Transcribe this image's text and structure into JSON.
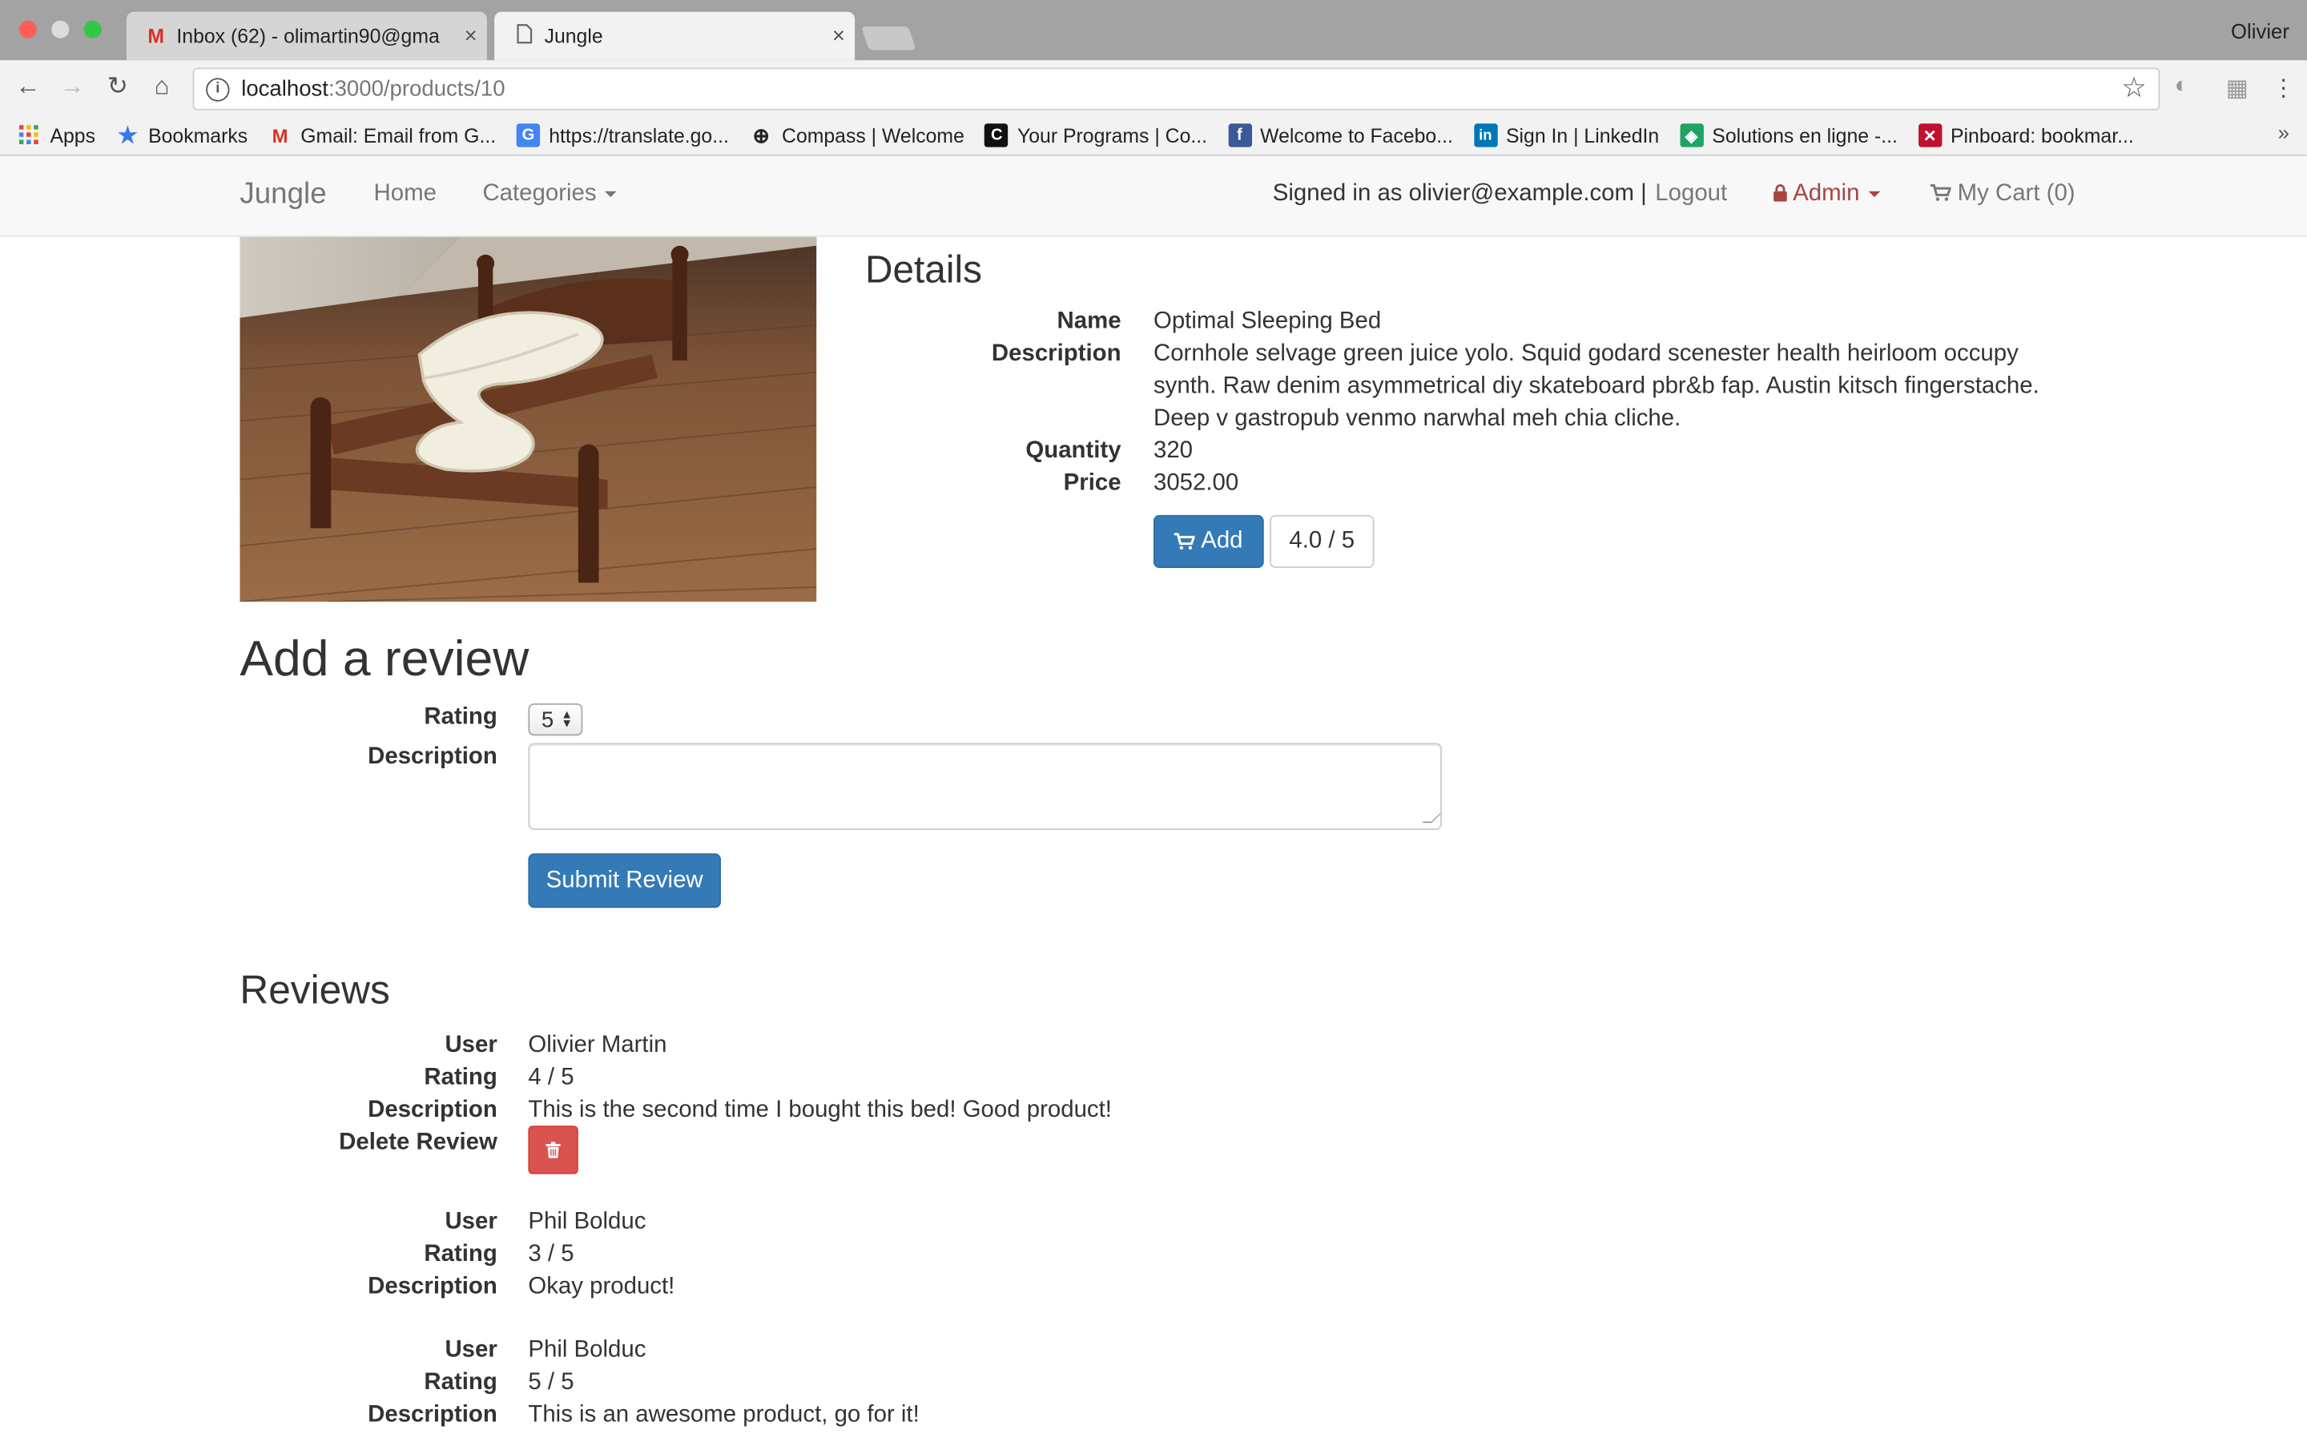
{
  "browser": {
    "tabs": [
      {
        "title": "Inbox (62) - olimartin90@gma",
        "favicon": "gmail-icon"
      },
      {
        "title": "Jungle",
        "favicon": "page-icon"
      }
    ],
    "window_user": "Olivier",
    "url": {
      "host": "localhost",
      "path": ":3000/products/10"
    },
    "bookmarks": [
      {
        "label": "Apps",
        "icon": "apps-grid-icon"
      },
      {
        "label": "Bookmarks",
        "icon": "star-icon"
      },
      {
        "label": "Gmail: Email from G...",
        "icon": "gmail-icon"
      },
      {
        "label": "https://translate.go...",
        "icon": "google-translate-icon"
      },
      {
        "label": "Compass | Welcome",
        "icon": "compass-icon"
      },
      {
        "label": "Your Programs | Co...",
        "icon": "coursera-icon"
      },
      {
        "label": "Welcome to Facebo...",
        "icon": "facebook-icon"
      },
      {
        "label": "Sign In | LinkedIn",
        "icon": "linkedin-icon"
      },
      {
        "label": "Solutions en ligne -...",
        "icon": "solutions-icon"
      },
      {
        "label": "Pinboard: bookmar...",
        "icon": "pinboard-icon"
      }
    ],
    "bookmarks_overflow": "»"
  },
  "nav": {
    "brand": "Jungle",
    "home": "Home",
    "categories": "Categories",
    "signed_in": "Signed in as olivier@example.com |",
    "logout": "Logout",
    "admin": "Admin",
    "cart": "My Cart (0)"
  },
  "product": {
    "heading": "Details",
    "labels": {
      "name": "Name",
      "description": "Description",
      "quantity": "Quantity",
      "price": "Price"
    },
    "name": "Optimal Sleeping Bed",
    "description": "Cornhole selvage green juice yolo. Squid godard scenester health heirloom occupy synth. Raw denim asymmetrical diy skateboard pbr&b fap. Austin kitsch fingerstache. Deep v gastropub venmo narwhal meh chia cliche.",
    "quantity": "320",
    "price": "3052.00",
    "add_button": "Add",
    "rating_badge": "4.0 / 5"
  },
  "review_form": {
    "heading": "Add a review",
    "rating_label": "Rating",
    "rating_value": "5",
    "description_label": "Description",
    "description_value": "",
    "submit": "Submit Review"
  },
  "reviews": {
    "heading": "Reviews",
    "labels": {
      "user": "User",
      "rating": "Rating",
      "description": "Description",
      "delete": "Delete Review"
    },
    "items": [
      {
        "user": "Olivier Martin",
        "rating": "4 / 5",
        "description": "This is the second time I bought this bed! Good product!",
        "deletable": true
      },
      {
        "user": "Phil Bolduc",
        "rating": "3 / 5",
        "description": "Okay product!",
        "deletable": false
      },
      {
        "user": "Phil Bolduc",
        "rating": "5 / 5",
        "description": "This is an awesome product, go for it!",
        "deletable": false
      }
    ]
  },
  "colors": {
    "primary": "#337ab7",
    "danger": "#d9534f",
    "admin": "#a94442",
    "navbar_bg": "#f8f8f8"
  }
}
